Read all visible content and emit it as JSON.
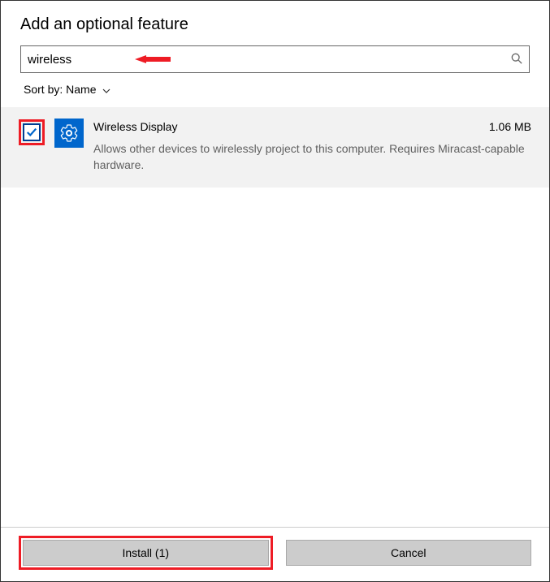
{
  "title": "Add an optional feature",
  "search": {
    "value": "wireless"
  },
  "sort": {
    "prefix": "Sort by:",
    "value": "Name"
  },
  "feature": {
    "name": "Wireless Display",
    "size": "1.06 MB",
    "description": "Allows other devices to wirelessly project to this computer.  Requires Miracast-capable hardware."
  },
  "buttons": {
    "install": "Install (1)",
    "cancel": "Cancel"
  }
}
